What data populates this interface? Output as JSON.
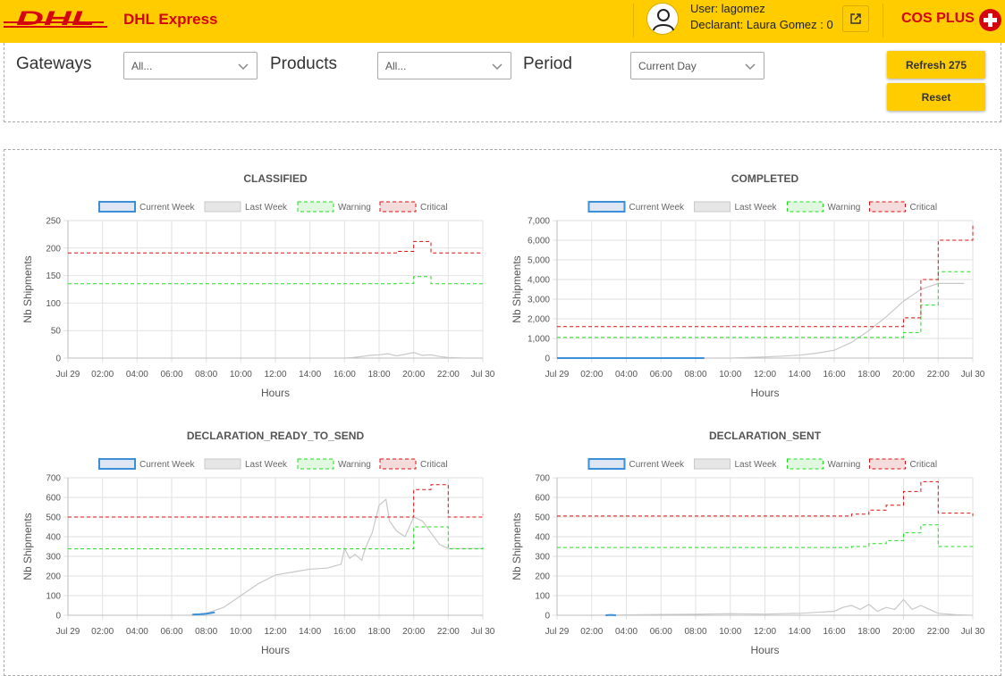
{
  "header": {
    "brand": "DHL Express",
    "user_line": "User: lagomez",
    "declarant_line": "Declarant: Laura Gomez : 0",
    "product_title": "COS PLUS"
  },
  "filters": {
    "gateways": {
      "label": "Gateways",
      "value": "All..."
    },
    "products": {
      "label": "Products",
      "value": "All..."
    },
    "period": {
      "label": "Period",
      "value": "Current Day"
    },
    "refresh_label": "Refresh 275",
    "reset_label": "Reset"
  },
  "colors": {
    "brand_yellow": "#ffcc00",
    "brand_red": "#d40511",
    "current_week": "#3a8fd8",
    "last_week": "#c8c8c8",
    "warning": "#22dd22",
    "critical": "#dd1111"
  },
  "chart_data": [
    {
      "type": "line",
      "title": "CLASSIFIED",
      "xlabel": "Hours",
      "ylabel": "Nb Shipments",
      "xlim": [
        0,
        24
      ],
      "ylim": [
        0,
        250
      ],
      "yticks": [
        0,
        50,
        100,
        150,
        200,
        250
      ],
      "ytick_labels": [
        "0",
        "50",
        "100",
        "150",
        "200",
        "250"
      ],
      "xticks": [
        0,
        2,
        4,
        6,
        8,
        10,
        12,
        14,
        16,
        18,
        20,
        22,
        24
      ],
      "xtick_labels": [
        "Jul 29",
        "02:00",
        "04:00",
        "06:00",
        "08:00",
        "10:00",
        "12:00",
        "14:00",
        "16:00",
        "18:00",
        "20:00",
        "22:00",
        "Jul 30"
      ],
      "legend": [
        "Current Week",
        "Last Week",
        "Warning",
        "Critical"
      ],
      "grid": true,
      "series": [
        {
          "name": "Current Week",
          "x": [],
          "y": []
        },
        {
          "name": "Last Week",
          "x": [
            16,
            16.5,
            17,
            17.5,
            18,
            18.5,
            19,
            19.5,
            20,
            20.5,
            21,
            21.5,
            22,
            23,
            24
          ],
          "y": [
            0,
            1,
            3,
            5,
            6,
            8,
            4,
            7,
            10,
            5,
            6,
            3,
            1,
            0,
            0
          ]
        },
        {
          "name": "Warning",
          "x": [
            0,
            18,
            19,
            20,
            21,
            24
          ],
          "y": [
            135,
            135,
            136,
            148,
            135,
            135
          ]
        },
        {
          "name": "Critical",
          "x": [
            0,
            18,
            19,
            20,
            21,
            24
          ],
          "y": [
            191,
            191,
            194,
            212,
            191,
            191
          ]
        }
      ]
    },
    {
      "type": "line",
      "title": "COMPLETED",
      "xlabel": "Hours",
      "ylabel": "Nb Shipments",
      "xlim": [
        0,
        24
      ],
      "ylim": [
        0,
        7000
      ],
      "yticks": [
        0,
        1000,
        2000,
        3000,
        4000,
        5000,
        6000,
        7000
      ],
      "ytick_labels": [
        "0",
        "1,000",
        "2,000",
        "3,000",
        "4,000",
        "5,000",
        "6,000",
        "7,000"
      ],
      "xticks": [
        0,
        2,
        4,
        6,
        8,
        10,
        12,
        14,
        16,
        18,
        20,
        22,
        24
      ],
      "xtick_labels": [
        "Jul 29",
        "02:00",
        "04:00",
        "06:00",
        "08:00",
        "10:00",
        "12:00",
        "14:00",
        "16:00",
        "18:00",
        "20:00",
        "22:00",
        "Jul 30"
      ],
      "legend": [
        "Current Week",
        "Last Week",
        "Warning",
        "Critical"
      ],
      "grid": true,
      "series": [
        {
          "name": "Current Week",
          "x": [
            0,
            8.5
          ],
          "y": [
            0,
            0
          ]
        },
        {
          "name": "Last Week",
          "x": [
            0,
            10,
            11,
            12,
            13,
            14,
            15,
            16,
            17,
            18,
            19,
            20,
            21,
            22,
            23.5
          ],
          "y": [
            0,
            0,
            30,
            60,
            100,
            150,
            250,
            400,
            800,
            1400,
            2100,
            2900,
            3500,
            3800,
            3800
          ]
        },
        {
          "name": "Warning",
          "x": [
            0,
            19,
            20,
            21,
            22,
            24
          ],
          "y": [
            1050,
            1050,
            1300,
            2700,
            4400,
            4400
          ]
        },
        {
          "name": "Critical",
          "x": [
            0,
            19,
            20,
            21,
            22,
            24
          ],
          "y": [
            1600,
            1600,
            2050,
            4000,
            6000,
            6800
          ]
        }
      ]
    },
    {
      "type": "line",
      "title": "DECLARATION_READY_TO_SEND",
      "xlabel": "Hours",
      "ylabel": "Nb Shipments",
      "xlim": [
        0,
        24
      ],
      "ylim": [
        0,
        700
      ],
      "yticks": [
        0,
        100,
        200,
        300,
        400,
        500,
        600,
        700
      ],
      "ytick_labels": [
        "0",
        "100",
        "200",
        "300",
        "400",
        "500",
        "600",
        "700"
      ],
      "xticks": [
        0,
        2,
        4,
        6,
        8,
        10,
        12,
        14,
        16,
        18,
        20,
        22,
        24
      ],
      "xtick_labels": [
        "Jul 29",
        "02:00",
        "04:00",
        "06:00",
        "08:00",
        "10:00",
        "12:00",
        "14:00",
        "16:00",
        "18:00",
        "20:00",
        "22:00",
        "Jul 30"
      ],
      "legend": [
        "Current Week",
        "Last Week",
        "Warning",
        "Critical"
      ],
      "grid": true,
      "series": [
        {
          "name": "Current Week",
          "x": [
            7.2,
            7.6,
            8.0,
            8.3,
            8.5
          ],
          "y": [
            3,
            5,
            8,
            12,
            15
          ]
        },
        {
          "name": "Last Week",
          "x": [
            7,
            8,
            9,
            10,
            11,
            12,
            13,
            14,
            15,
            15.8,
            16,
            16.3,
            16.6,
            17,
            17.2,
            17.6,
            18,
            18.4,
            18.6,
            19,
            19.5,
            20,
            20.5,
            21,
            21.5,
            22,
            23,
            24
          ],
          "y": [
            0,
            10,
            40,
            100,
            160,
            205,
            220,
            235,
            240,
            260,
            340,
            290,
            310,
            280,
            340,
            420,
            560,
            590,
            480,
            430,
            400,
            500,
            480,
            420,
            360,
            340,
            340,
            340
          ]
        },
        {
          "name": "Warning",
          "x": [
            0,
            19,
            20,
            21,
            22,
            23,
            24
          ],
          "y": [
            338,
            338,
            450,
            450,
            338,
            338,
            345
          ]
        },
        {
          "name": "Critical",
          "x": [
            0,
            19,
            20,
            21,
            22,
            23,
            24
          ],
          "y": [
            500,
            500,
            640,
            665,
            500,
            500,
            515
          ]
        }
      ]
    },
    {
      "type": "line",
      "title": "DECLARATION_SENT",
      "xlabel": "Hours",
      "ylabel": "Nb Shipments",
      "xlim": [
        0,
        24
      ],
      "ylim": [
        0,
        700
      ],
      "yticks": [
        0,
        100,
        200,
        300,
        400,
        500,
        600,
        700
      ],
      "ytick_labels": [
        "0",
        "100",
        "200",
        "300",
        "400",
        "500",
        "600",
        "700"
      ],
      "xticks": [
        0,
        2,
        4,
        6,
        8,
        10,
        12,
        14,
        16,
        18,
        20,
        22,
        24
      ],
      "xtick_labels": [
        "Jul 29",
        "02:00",
        "04:00",
        "06:00",
        "08:00",
        "10:00",
        "12:00",
        "14:00",
        "16:00",
        "18:00",
        "20:00",
        "22:00",
        "Jul 30"
      ],
      "legend": [
        "Current Week",
        "Last Week",
        "Warning",
        "Critical"
      ],
      "grid": true,
      "series": [
        {
          "name": "Current Week",
          "x": [
            2.8,
            3.1,
            3.4
          ],
          "y": [
            0,
            2,
            0
          ]
        },
        {
          "name": "Last Week",
          "x": [
            2,
            4,
            6,
            8,
            10,
            12,
            14,
            15,
            16,
            16.5,
            17,
            17.5,
            18,
            18.5,
            19,
            19.5,
            20,
            20.5,
            21,
            21.5,
            22,
            23,
            24
          ],
          "y": [
            0,
            2,
            4,
            5,
            8,
            6,
            10,
            15,
            20,
            40,
            50,
            30,
            55,
            20,
            40,
            30,
            80,
            30,
            50,
            30,
            10,
            3,
            0
          ]
        },
        {
          "name": "Warning",
          "x": [
            0,
            16,
            17,
            18,
            19,
            20,
            21,
            22,
            24
          ],
          "y": [
            345,
            345,
            350,
            365,
            380,
            420,
            460,
            350,
            345
          ]
        },
        {
          "name": "Critical",
          "x": [
            0,
            16,
            17,
            18,
            19,
            20,
            21,
            22,
            24
          ],
          "y": [
            505,
            505,
            515,
            535,
            560,
            630,
            680,
            520,
            505
          ]
        }
      ]
    }
  ]
}
